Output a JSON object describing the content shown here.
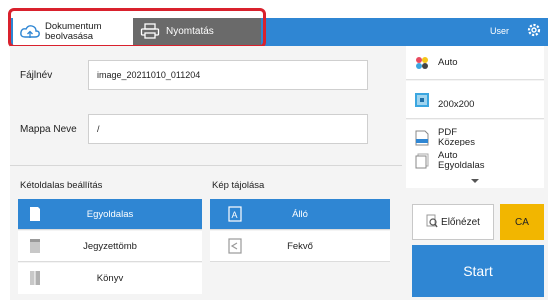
{
  "tabs": {
    "scan_label": "Dokumentum beolvasása",
    "print_label": "Nyomtatás"
  },
  "header": {
    "user_label": "User"
  },
  "fields": {
    "filename_label": "Fájlnév",
    "filename_value": "image_20211010_011204",
    "folder_label": "Mappa Neve",
    "folder_value": "/"
  },
  "duplex": {
    "title": "Kétoldalas beállítás",
    "options": [
      "Egyoldalas",
      "Jegyzettömb",
      "Könyv"
    ],
    "selected": "Egyoldalas"
  },
  "orientation": {
    "title": "Kép tájolása",
    "options": [
      "Álló",
      "Fekvő"
    ],
    "selected": "Álló"
  },
  "side": {
    "color_mode": "Auto",
    "resolution": "200x200",
    "format_line1": "PDF",
    "format_line2": "Közepes",
    "sides_line1": "Auto",
    "sides_line2": "Egyoldalas"
  },
  "actions": {
    "preview_label": "Előnézet",
    "ca_label": "CA",
    "start_label": "Start"
  },
  "colors": {
    "accent": "#2f86d3",
    "highlight": "#d9212d",
    "ca": "#f2b600",
    "print_tab": "#6a6a6a"
  },
  "icons": [
    "cloud-scan-icon",
    "printer-icon",
    "gear-icon",
    "color-dots-icon",
    "resolution-icon",
    "file-format-icon",
    "pages-icon",
    "chevron-down-icon",
    "preview-icon",
    "one-sided-icon",
    "notepad-icon",
    "book-icon",
    "portrait-icon",
    "landscape-icon"
  ]
}
